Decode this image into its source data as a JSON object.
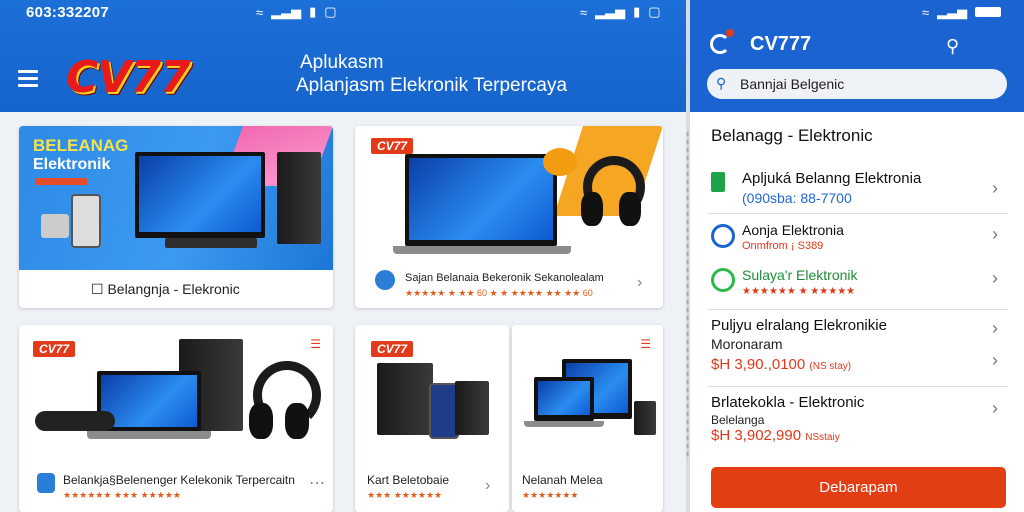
{
  "status_bar": {
    "time": "603:332207"
  },
  "left_app": {
    "logo": "CV77",
    "subtitle_line1": "Aplukasm",
    "subtitle_line2": "Aplanjasm Elekronik Terpercaya",
    "cards": [
      {
        "banner_line1": "BELEANAG",
        "banner_line2": "Elektronik",
        "footer": "☐ Belangnja - Elekronic"
      },
      {
        "badge": "CV77",
        "footer": "Sajan Belanaia Bekeronik Sekanolealam",
        "rating": "★★★★★ ★ ★★ 60 ★ ★ ★★★★ ★★ ★★ 60"
      },
      {
        "badge": "CV77",
        "footer": "Belankja§Belenenger Kelekonik Terpercaitn",
        "rating": "★★★★★★ ★★★ ★★★★★"
      },
      {
        "badge": "CV77",
        "footer": "Kart Beletobaie",
        "rating": "★★★ ★★★★★★"
      },
      {
        "footer": "Nelanah Melea",
        "rating": "★★★★★★★"
      }
    ]
  },
  "right_app": {
    "title": "CV777",
    "search_text": "Bannjai Belgenic",
    "section_title": "Belanagg - Elektronic",
    "list": [
      {
        "title": "Apljuká Belanng Elektronia",
        "sub": "(090sba: 88-7700"
      },
      {
        "title": "Aonja Elektronia",
        "sub": "Onmfrom ¡ S389"
      },
      {
        "title": "Sulaya'r Elektronik",
        "sub": "★★★★★★ ★ ★★★★★"
      },
      {
        "title": "Puljyu elralang Elekronikie",
        "sub": "Moronaram",
        "price": "$H 3,90.,0100",
        "price_note": "(NS stay)"
      },
      {
        "title": "Brlatekokla - Elektronic",
        "sub": "Belelanga",
        "price": "$H 3,902,990",
        "price_note": "NSstaiy"
      }
    ],
    "cta_label": "Debarapam"
  },
  "colors": {
    "header_blue": "#1a63d1",
    "accent_red": "#e23e14"
  }
}
